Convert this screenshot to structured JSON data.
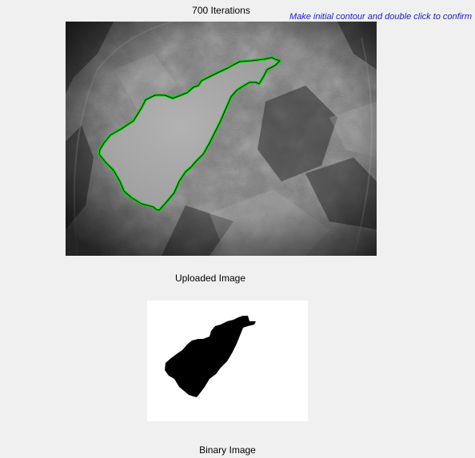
{
  "main": {
    "title": "700 Iterations",
    "instruction": "Make initial contour and double click to confirm"
  },
  "panels": {
    "uploaded_caption": "Uploaded Image",
    "binary_caption": "Binary Image"
  },
  "colors": {
    "background": "#f0f0f0",
    "instruction_text": "#1a1acc",
    "contour": "#00d800"
  }
}
